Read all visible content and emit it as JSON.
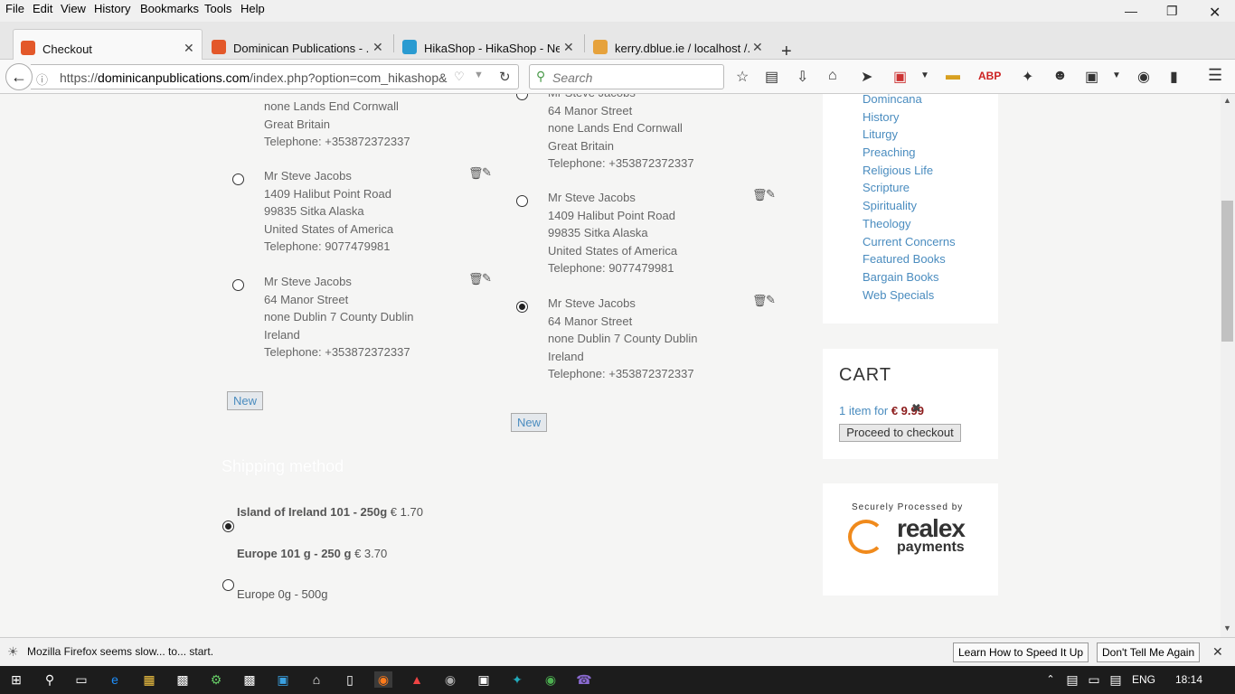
{
  "menu": [
    "File",
    "Edit",
    "View",
    "History",
    "Bookmarks",
    "Tools",
    "Help"
  ],
  "tabs": [
    {
      "label": "Checkout",
      "color": "#e3582a"
    },
    {
      "label": "Dominican Publications - ...",
      "color": "#e3582a"
    },
    {
      "label": "HikaShop - HikaShop - Ne...",
      "color": "#2a9bd1"
    },
    {
      "label": "kerry.dblue.ie / localhost /...",
      "color": "#e6a23c"
    }
  ],
  "url": {
    "prefix": "https://",
    "domain": "dominicanpublications.com",
    "path": "/index.php?option=com_hikashop&"
  },
  "search_placeholder": "Search",
  "billing_col": {
    "partial": {
      "lines": [
        "none Lands End Cornwall",
        "Great Britain",
        "Telephone: +353872372337"
      ]
    },
    "addresses": [
      {
        "lines": [
          "Mr Steve Jacobs",
          "1409 Halibut Point Road",
          "99835 Sitka Alaska",
          "United States of America",
          "Telephone: 9077479981"
        ],
        "selected": false
      },
      {
        "lines": [
          "Mr Steve Jacobs",
          "64 Manor Street",
          "none Dublin 7 County Dublin",
          "Ireland",
          "Telephone: +353872372337"
        ],
        "selected": false
      }
    ],
    "new_label": "New"
  },
  "shipping_col": {
    "partial": {
      "lines": [
        "Mr Steve Jacobs",
        "64 Manor Street",
        "none Lands End Cornwall",
        "Great Britain",
        "Telephone: +353872372337"
      ]
    },
    "addresses": [
      {
        "lines": [
          "Mr Steve Jacobs",
          "1409 Halibut Point Road",
          "99835 Sitka Alaska",
          "United States of America",
          "Telephone: 9077479981"
        ],
        "selected": false
      },
      {
        "lines": [
          "Mr Steve Jacobs",
          "64 Manor Street",
          "none Dublin 7 County Dublin",
          "Ireland",
          "Telephone: +353872372337"
        ],
        "selected": true
      }
    ],
    "new_label": "New"
  },
  "shipping_method": {
    "title": "Shipping method",
    "options": [
      {
        "name": "Island of Ireland 101 - 250g",
        "price": "€ 1.70",
        "selected": true
      },
      {
        "name": "Europe 101 g - 250 g",
        "price": "€ 3.70",
        "selected": false
      },
      {
        "name": "Europe 0g - 500g",
        "price": "",
        "selected": false
      }
    ]
  },
  "categories": [
    "Domincana",
    "History",
    "Liturgy",
    "Preaching",
    "Religious Life",
    "Scripture",
    "Spirituality",
    "Theology",
    "Current Concerns",
    "Featured Books",
    "Bargain Books",
    "Web Specials"
  ],
  "cart": {
    "title": "CART",
    "items_text": "1 item for",
    "price": "€ 9.99",
    "checkout_label": "Proceed to checkout"
  },
  "realex": {
    "top": "Securely Processed by",
    "brand": "realex",
    "sub": "payments"
  },
  "notification": {
    "message": "Mozilla Firefox seems slow... to... start.",
    "learn": "Learn How to Speed It Up",
    "dismiss": "Don't Tell Me Again"
  },
  "taskbar": {
    "lang": "ENG",
    "time": "18:14"
  }
}
